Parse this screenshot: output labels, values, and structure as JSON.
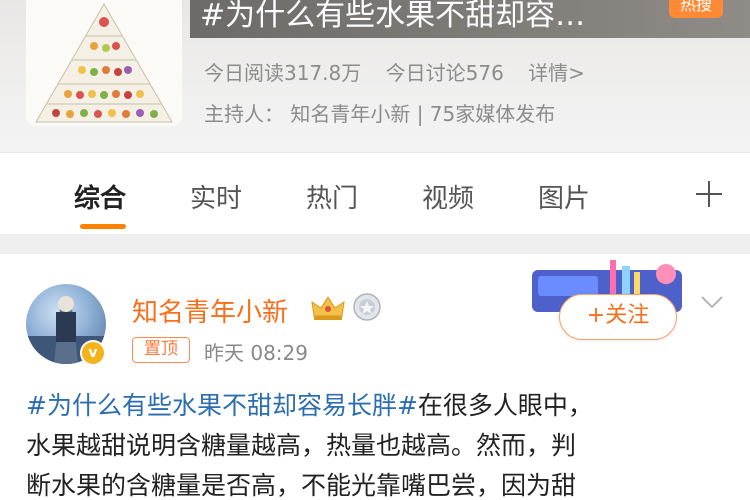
{
  "topic": {
    "title": "#为什么有些水果不甜却容…",
    "hot_badge": "热搜",
    "reads": "今日阅读317.8万",
    "discussions": "今日讨论576",
    "details_link": "详情>",
    "host": "主持人：  知名青年小新 | 75家媒体发布"
  },
  "tabs": [
    {
      "label": "综合",
      "active": true
    },
    {
      "label": "实时",
      "active": false
    },
    {
      "label": "热门",
      "active": false
    },
    {
      "label": "视频",
      "active": false
    },
    {
      "label": "图片",
      "active": false
    }
  ],
  "post": {
    "author": "知名青年小新",
    "pin_label": "置顶",
    "time": "昨天 08:29",
    "follow_label": "+关注",
    "hashtag": "#为什么有些水果不甜却容易长胖#",
    "text_line1": "在很多人眼中，",
    "text_line2": "水果越甜说明含糖量越高，热量也越高。然而，判",
    "text_line3": "断水果的含糖量是否高，不能光靠嘴巴尝，因为甜"
  },
  "colors": {
    "accent": "#ff8200",
    "author_name": "#f86e1a",
    "hashtag": "#2c6eb0",
    "hot_badge": "#ff8a36"
  },
  "icons": [
    "plus-icon",
    "crown-icon",
    "medal-icon",
    "verified-icon",
    "chevron-down-icon"
  ]
}
